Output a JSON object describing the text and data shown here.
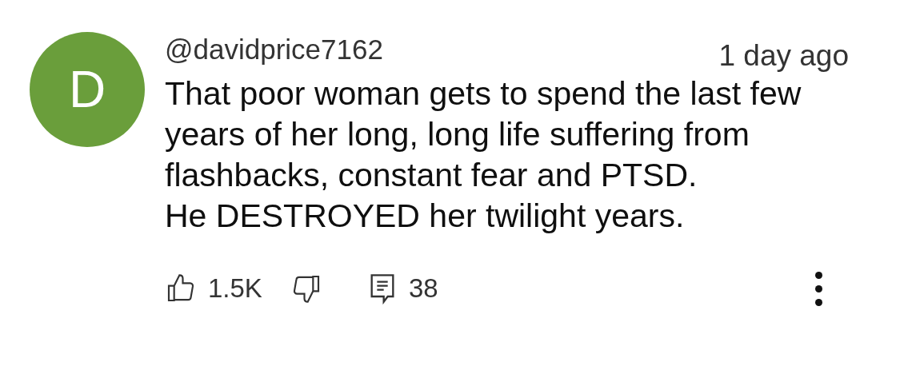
{
  "comment": {
    "avatar_letter": "D",
    "color": "#6a9e3b",
    "author": "@davidprice7162",
    "time": "1 day ago",
    "text_lines": [
      "That poor woman gets to spend the last few",
      "years of her long, long life suffering from",
      "flashbacks, constant fear and PTSD.",
      "He DESTROYED her twilight years."
    ],
    "likes": "1.5K",
    "replies": "38"
  }
}
